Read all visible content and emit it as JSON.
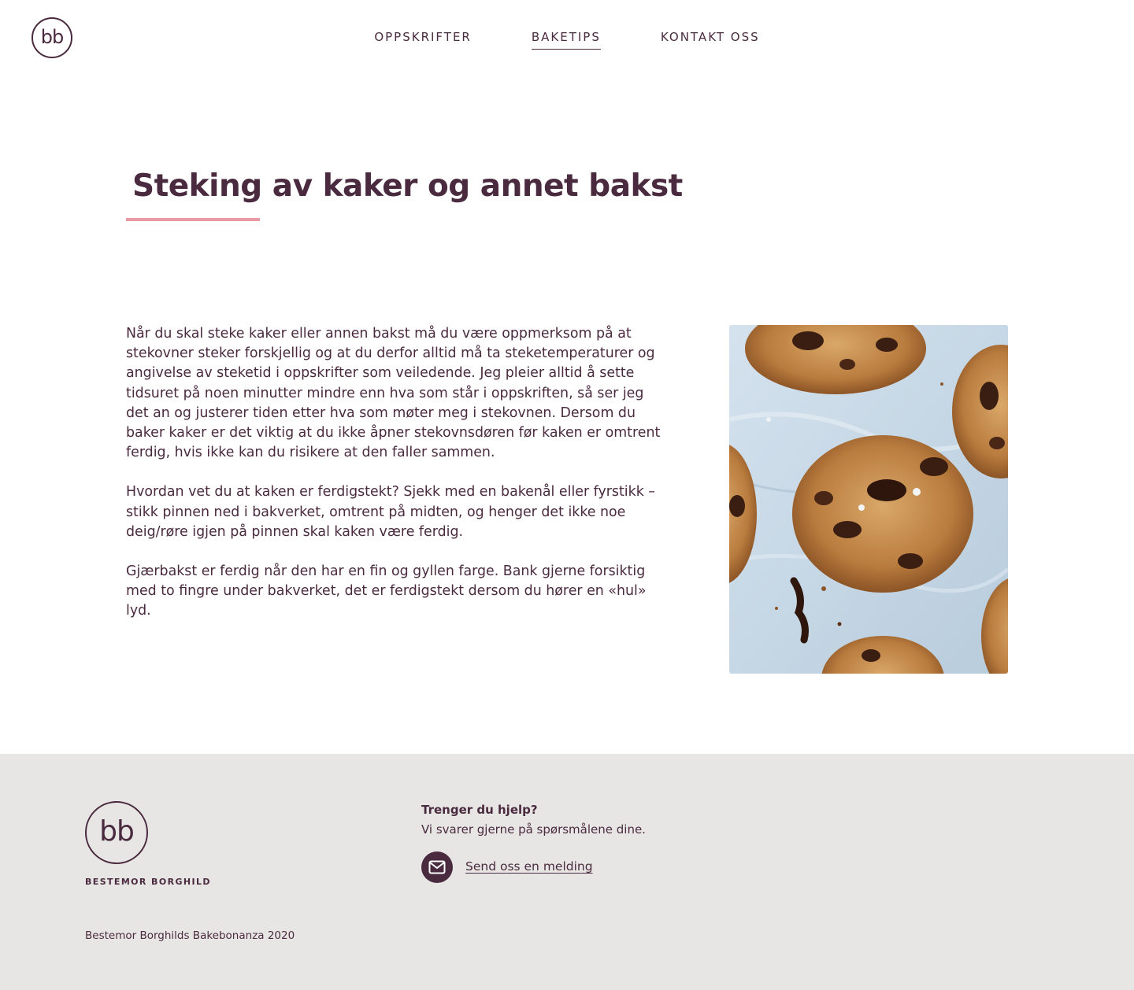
{
  "header": {
    "logo_text": "bb",
    "nav": [
      {
        "label": "OPPSKRIFTER",
        "active": false
      },
      {
        "label": "BAKETIPS",
        "active": true
      },
      {
        "label": "KONTAKT OSS",
        "active": false
      }
    ]
  },
  "main": {
    "title": "Steking av kaker og annet bakst",
    "paragraphs": [
      "Når du skal steke kaker eller annen bakst må du være oppmerksom på at stekovner steker forskjellig og at du derfor alltid må ta steketemperaturer og angivelse av steketid i oppskrifter som veiledende. Jeg pleier alltid å sette tidsuret på noen minutter mindre enn hva som står i oppskriften, så ser jeg det an og justerer tiden etter hva som møter meg i stekovnen. Dersom du baker kaker er det viktig at du ikke åpner stekovnsdøren før kaken er omtrent ferdig, hvis ikke kan du risikere at den faller sammen.",
      "Hvordan vet du at kaken er ferdigstekt? Sjekk med en bakenål eller fyrstikk – stikk pinnen ned i bakverket, omtrent på midten, og henger det ikke noe deig/røre igjen på pinnen skal kaken være ferdig.",
      "Gjærbakst er ferdig når den har en fin og gyllen farge. Bank gjerne forsiktig med to fingre under bakverket, det er ferdigstekt dersom du hører en «hul» lyd."
    ]
  },
  "footer": {
    "logo_text": "bb",
    "brand": "BESTEMOR BORGHILD",
    "help_title": "Trenger du hjelp?",
    "help_sub": "Vi svarer gjerne på spørsmålene dine.",
    "mail_link": "Send oss en melding",
    "mail_icon": "envelope-icon",
    "copyright": "Bestemor Borghilds Bakebonanza 2020"
  },
  "colors": {
    "brand": "#4a2a3e",
    "accent": "#e89aa3",
    "footer_bg": "#e8e6e5"
  }
}
